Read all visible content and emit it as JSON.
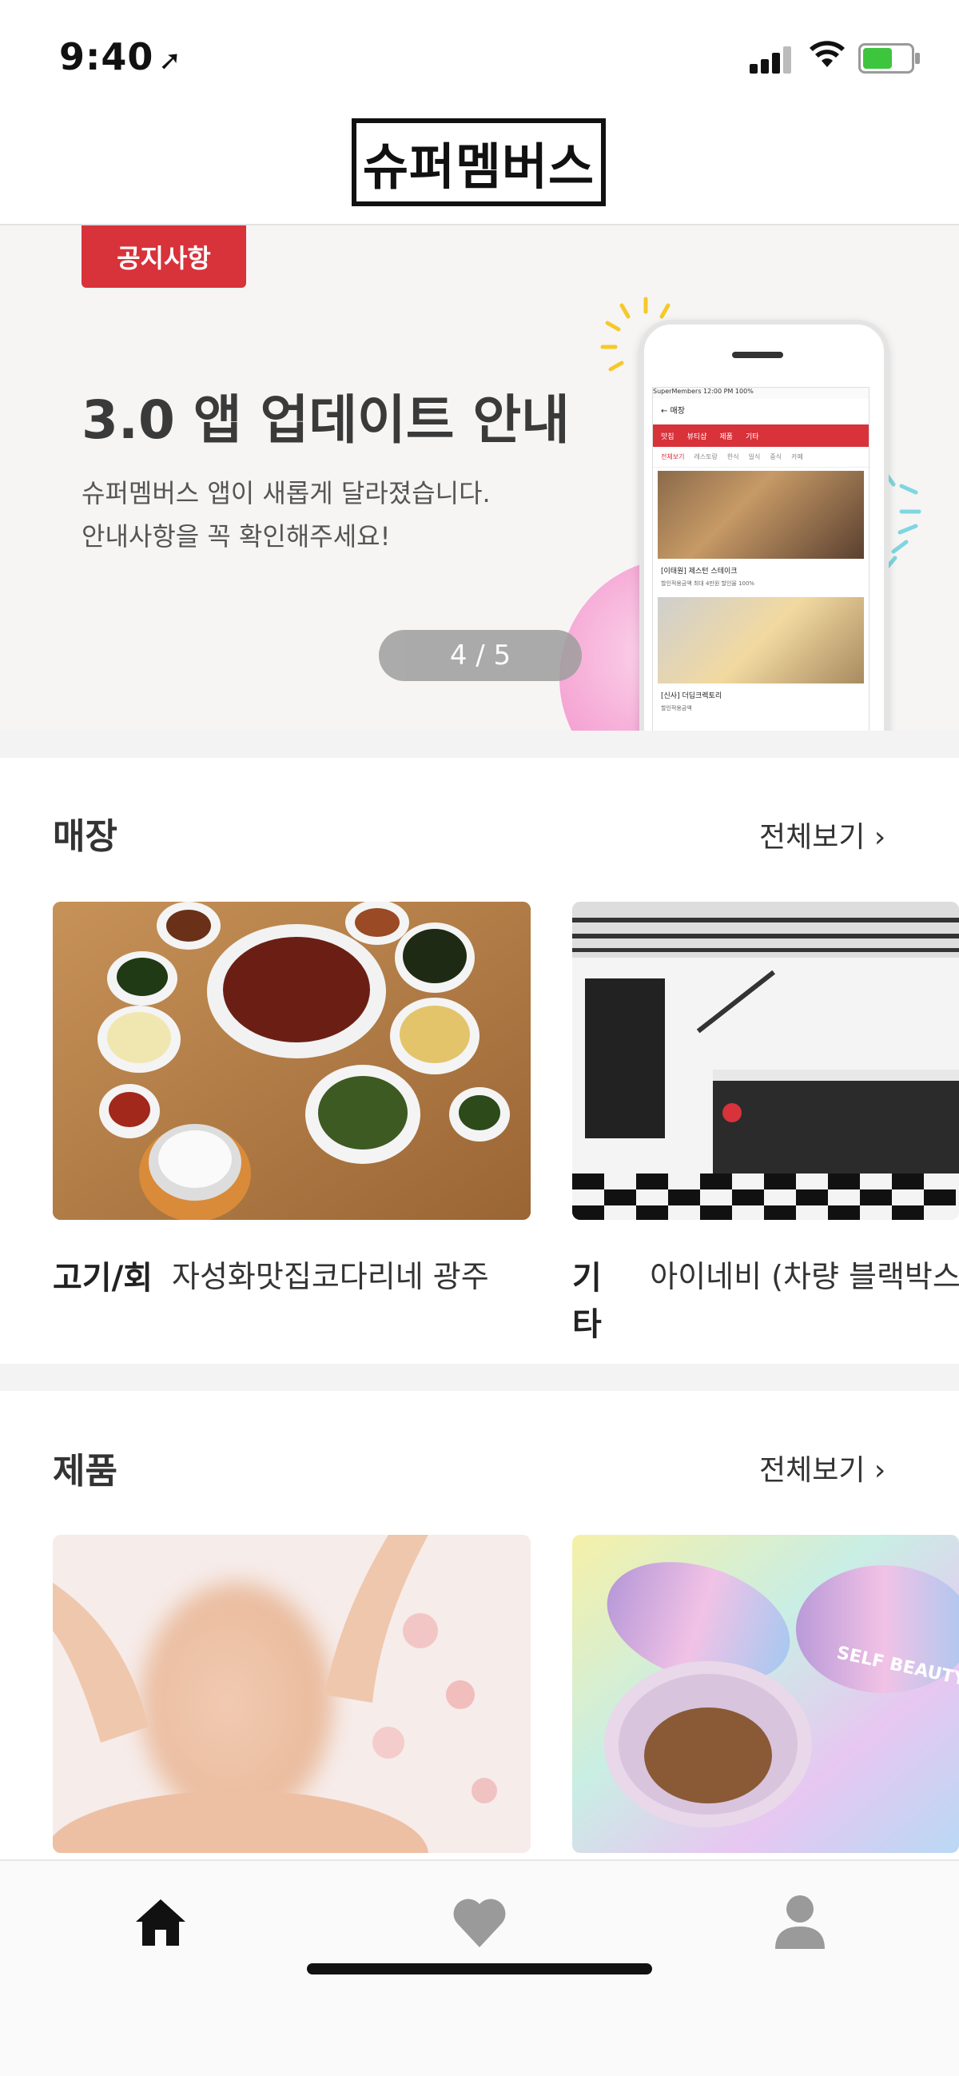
{
  "status_bar": {
    "time": "9:40",
    "location_glyph": "➚"
  },
  "header": {
    "logo_text": "슈퍼멤버스"
  },
  "banner": {
    "tag": "공지사항",
    "title": "3.0 앱 업데이트 안내",
    "desc_line1": "슈퍼멤버스 앱이 새롭게 달라졌습니다.",
    "desc_line2": "안내사항을 꼭 확인해주세요!",
    "pager": "4 / 5",
    "phone_screen": {
      "status": "SuperMembers 12:00 PM 100%",
      "header": "← 매장",
      "tabs": [
        "맛집",
        "뷰티샵",
        "제품",
        "기타"
      ],
      "subtabs": [
        "전체보기",
        "레스토랑",
        "한식",
        "일식",
        "중식",
        "카페"
      ],
      "item1_title": "[이태원] 제스턴 스테이크",
      "item1_meta": "할인적용금액  최대 4만원    할인율  100%",
      "item2_title": "[신사] 더딥크렉토리",
      "item2_meta": "할인적용금액"
    }
  },
  "stores": {
    "title": "매장",
    "see_all": "전체보기 ›",
    "cards": [
      {
        "category": "고기/회",
        "name": "자성화맛집코다리네 광주"
      },
      {
        "category": "기타",
        "name": "아이네비 (차량 블랙박스"
      }
    ]
  },
  "products": {
    "title": "제품",
    "see_all": "전체보기 ›",
    "cards": [
      {
        "label": ""
      },
      {
        "label": "SELF BEAUTY"
      }
    ]
  },
  "tabbar": {
    "items": [
      {
        "icon": "home-icon",
        "active": true
      },
      {
        "icon": "heart-icon",
        "active": false
      },
      {
        "icon": "person-icon",
        "active": false
      }
    ]
  },
  "colors": {
    "brand_red": "#d8323b",
    "active_icon": "#111111",
    "inactive_icon": "#9a9a9a"
  }
}
